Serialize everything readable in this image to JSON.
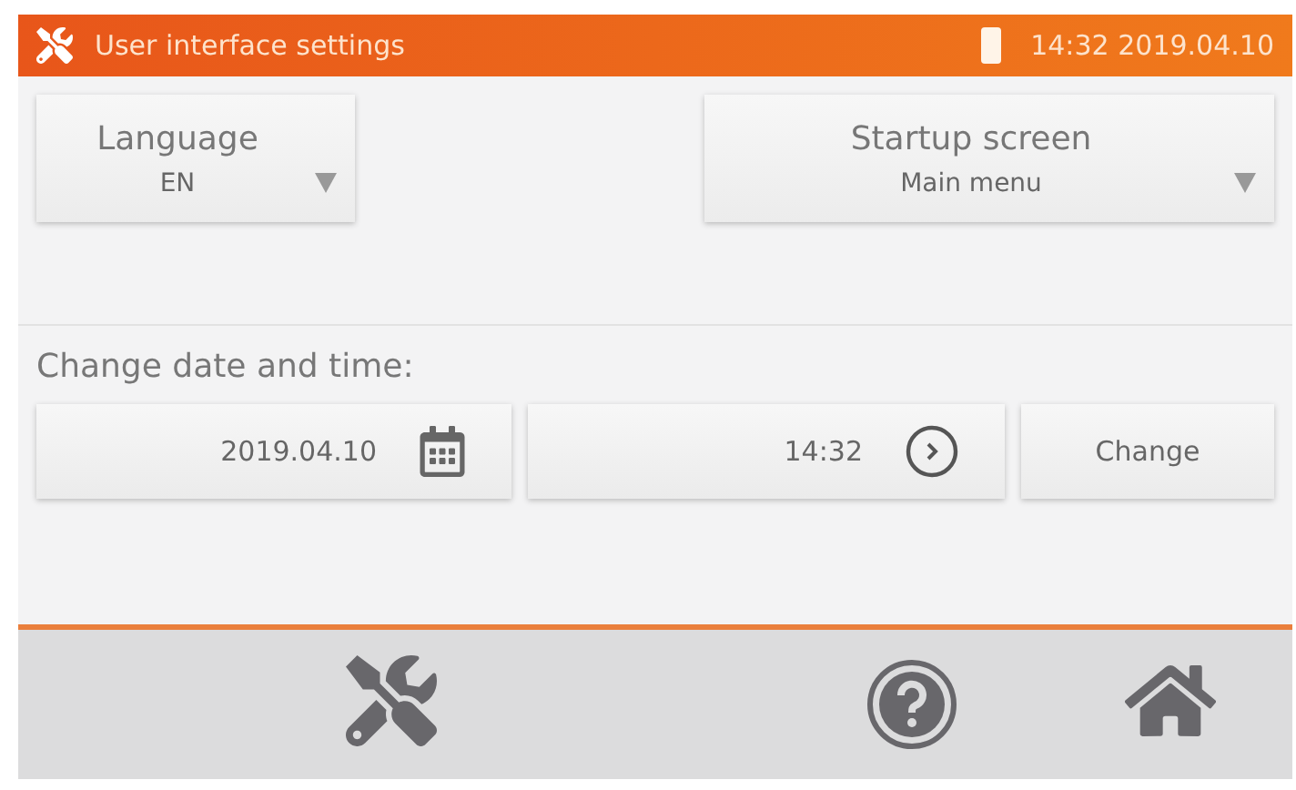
{
  "header": {
    "title": "User interface settings",
    "time": "14:32",
    "date": "2019.04.10"
  },
  "dropdowns": [
    {
      "label": "Language",
      "value": "EN",
      "wide": false
    },
    {
      "label": "Startup screen",
      "value": "Main menu",
      "wide": true
    }
  ],
  "datetime": {
    "label": "Change date and time:",
    "date": "2019.04.10",
    "time": "14:32",
    "button": "Change"
  }
}
